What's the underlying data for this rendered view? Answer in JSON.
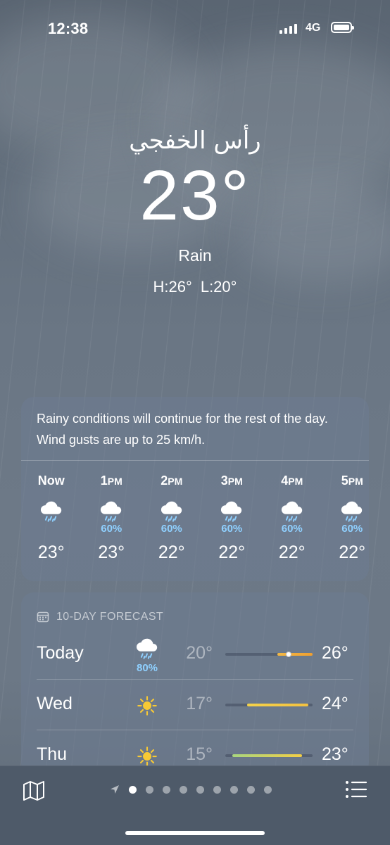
{
  "status_bar": {
    "time": "12:38",
    "network": "4G"
  },
  "location": {
    "city": "رأس الخفجي",
    "temperature": "23°",
    "condition": "Rain",
    "high": "H:26°",
    "low": "L:20°"
  },
  "hourly": {
    "summary": "Rainy conditions will continue for the rest of the day. Wind gusts are up to 25 km/h.",
    "hours": [
      {
        "time": "Now",
        "suffix": "",
        "icon": "cloud-rain-icon",
        "precip": "",
        "temp": "23°"
      },
      {
        "time": "1",
        "suffix": "PM",
        "icon": "cloud-rain-icon",
        "precip": "60%",
        "temp": "23°"
      },
      {
        "time": "2",
        "suffix": "PM",
        "icon": "cloud-rain-icon",
        "precip": "60%",
        "temp": "22°"
      },
      {
        "time": "3",
        "suffix": "PM",
        "icon": "cloud-rain-icon",
        "precip": "60%",
        "temp": "22°"
      },
      {
        "time": "4",
        "suffix": "PM",
        "icon": "cloud-rain-icon",
        "precip": "60%",
        "temp": "22°"
      },
      {
        "time": "5",
        "suffix": "PM",
        "icon": "cloud-rain-icon",
        "precip": "60%",
        "temp": "22°"
      }
    ]
  },
  "forecast": {
    "header": "10-DAY FORECAST",
    "days": [
      {
        "day": "Today",
        "icon": "cloud-rain-icon",
        "precip": "80%",
        "low": "20°",
        "high": "26°",
        "range_start": 0.6,
        "range_end": 1.0,
        "current": 0.6,
        "color_start": "#f3b845",
        "color_end": "#f0a030"
      },
      {
        "day": "Wed",
        "icon": "sun-icon",
        "precip": "",
        "low": "17°",
        "high": "24°",
        "range_start": 0.25,
        "range_end": 0.95,
        "color_start": "#f4d24a",
        "color_end": "#f3c140"
      },
      {
        "day": "Thu",
        "icon": "sun-icon",
        "precip": "",
        "low": "15°",
        "high": "23°",
        "range_start": 0.08,
        "range_end": 0.88,
        "color_start": "#a8d67f",
        "color_end": "#f3ce45"
      }
    ]
  },
  "tab_bar": {
    "page_count": 9,
    "active_index": 0
  },
  "colors": {
    "precip": "#8fd0ff",
    "sun": "#f7c935",
    "card": "rgba(110,123,145,0.55)"
  }
}
